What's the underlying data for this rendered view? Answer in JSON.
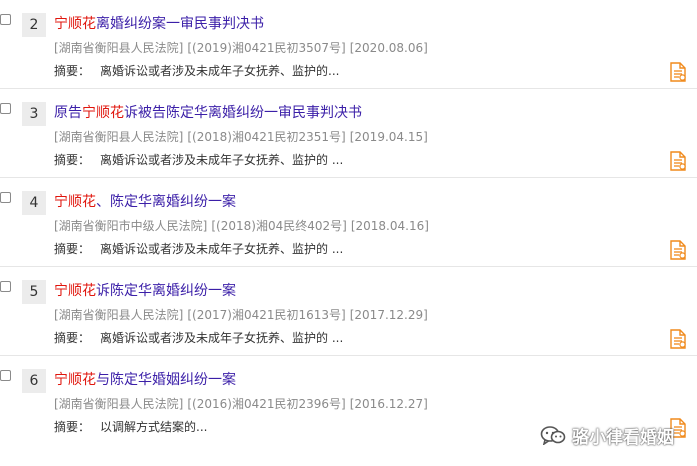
{
  "results": [
    {
      "number": "2",
      "title_highlight": "宁顺花",
      "title_pre": "",
      "title_rest": "离婚纠纷案一审民事判决书",
      "court": "[湖南省衡阳县人民法院]",
      "case_no": "[(2019)湘0421民初3507号]",
      "date": "[2020.08.06]",
      "summary_label": "摘要：",
      "summary_text": "离婚诉讼或者涉及未成年子女抚养、监护的..."
    },
    {
      "number": "3",
      "title_highlight": "宁顺花",
      "title_pre": "原告",
      "title_rest": "诉被告陈定华离婚纠纷一审民事判决书",
      "court": "[湖南省衡阳县人民法院]",
      "case_no": "[(2018)湘0421民初2351号]",
      "date": "[2019.04.15]",
      "summary_label": "摘要：",
      "summary_text": "离婚诉讼或者涉及未成年子女抚养、监护的 ..."
    },
    {
      "number": "4",
      "title_highlight": "宁顺花",
      "title_pre": "",
      "title_rest": "、陈定华离婚纠纷一案",
      "court": "[湖南省衡阳市中级人民法院]",
      "case_no": "[(2018)湘04民终402号]",
      "date": "[2018.04.16]",
      "summary_label": "摘要：",
      "summary_text": "离婚诉讼或者涉及未成年子女抚养、监护的 ..."
    },
    {
      "number": "5",
      "title_highlight": "宁顺花",
      "title_pre": "",
      "title_rest": "诉陈定华离婚纠纷一案",
      "court": "[湖南省衡阳县人民法院]",
      "case_no": "[(2017)湘0421民初1613号]",
      "date": "[2017.12.29]",
      "summary_label": "摘要：",
      "summary_text": "离婚诉讼或者涉及未成年子女抚养、监护的 ..."
    },
    {
      "number": "6",
      "title_highlight": "宁顺花",
      "title_pre": "",
      "title_rest": "与陈定华婚姻纠纷一案",
      "court": "[湖南省衡阳县人民法院]",
      "case_no": "[(2016)湘0421民初2396号]",
      "date": "[2016.12.27]",
      "summary_label": "摘要：",
      "summary_text": "以调解方式结案的..."
    }
  ],
  "watermark": {
    "text": "骆小律看婚姻",
    "icon": "wechat-icon"
  },
  "colors": {
    "title_link": "#3b1fa8",
    "highlight": "#e0150c",
    "meta_gray": "#8a8a8a",
    "icon_orange": "#f08a1c"
  }
}
